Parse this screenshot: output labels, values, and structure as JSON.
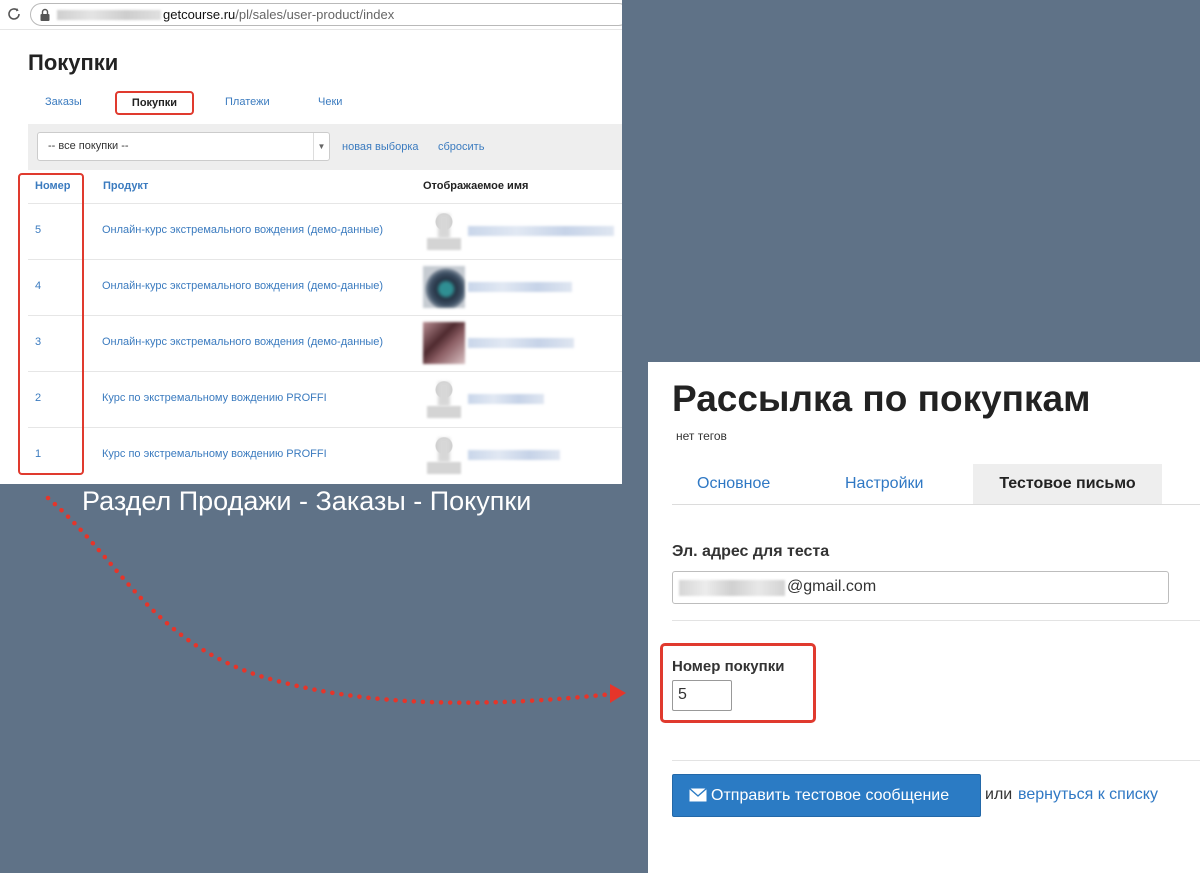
{
  "browser": {
    "url_host": "getcourse.ru",
    "url_path": "/pl/sales/user-product/index"
  },
  "purchases_page": {
    "title": "Покупки",
    "tabs": [
      {
        "label": "Заказы"
      },
      {
        "label": "Покупки"
      },
      {
        "label": "Платежи"
      },
      {
        "label": "Чеки"
      }
    ],
    "filter": {
      "select_value": "-- все покупки --",
      "new_selection": "новая выборка",
      "reset": "сбросить"
    },
    "columns": {
      "number": "Номер",
      "product": "Продукт",
      "display_name": "Отображаемое имя"
    },
    "rows": [
      {
        "number": "5",
        "product": "Онлайн-курс экстремального вождения (демо-данные)"
      },
      {
        "number": "4",
        "product": "Онлайн-курс экстремального вождения (демо-данные)"
      },
      {
        "number": "3",
        "product": "Онлайн-курс экстремального вождения (демо-данные)"
      },
      {
        "number": "2",
        "product": "Курс по экстремальному вождению PROFFI"
      },
      {
        "number": "1",
        "product": "Курс по экстремальному вождению PROFFI"
      }
    ]
  },
  "caption": "Раздел Продажи - Заказы - Покупки",
  "mailing": {
    "title": "Рассылка по покупкам",
    "tags": "нет тегов",
    "tabs": [
      {
        "label": "Основное"
      },
      {
        "label": "Настройки"
      },
      {
        "label": "Тестовое письмо"
      }
    ],
    "email_label": "Эл. адрес для теста",
    "email_value": "@gmail.com",
    "purchase_label": "Номер покупки",
    "purchase_value": "5",
    "send_button": "Отправить тестовое сообщение",
    "or_text": "или",
    "back_link": "вернуться к списку"
  },
  "colors": {
    "background": "#5f7287",
    "link": "#3b7bbf",
    "highlight": "#e03a2e",
    "button": "#2b7bc4"
  },
  "icons": [
    "reload-icon",
    "lock-icon",
    "chevron-down-icon",
    "envelope-icon",
    "arrow-icon"
  ]
}
